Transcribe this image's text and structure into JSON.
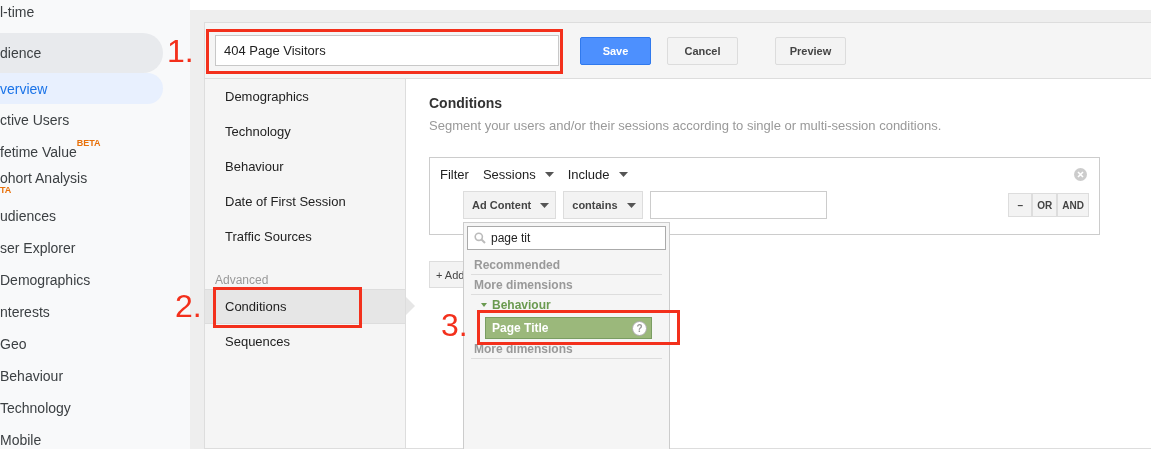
{
  "sidebar": {
    "items": [
      {
        "label": "l-time",
        "kind": "page",
        "selected": false
      },
      {
        "label": "dience",
        "kind": "group",
        "selected": false
      },
      {
        "label": "verview",
        "kind": "page",
        "selected": true
      },
      {
        "label": "ctive Users",
        "kind": "page",
        "selected": false
      },
      {
        "label": "fetime Value",
        "kind": "page",
        "selected": false,
        "badge": "BETA",
        "badge_wrapped": false
      },
      {
        "label": "ohort Analysis",
        "kind": "page",
        "selected": false,
        "badge": "TA",
        "badge_wrapped": true
      },
      {
        "label": "udiences",
        "kind": "page",
        "selected": false
      },
      {
        "label": "ser Explorer",
        "kind": "page",
        "selected": false
      },
      {
        "label": "Demographics",
        "kind": "page",
        "selected": false
      },
      {
        "label": "nterests",
        "kind": "page",
        "selected": false
      },
      {
        "label": "Geo",
        "kind": "page",
        "selected": false
      },
      {
        "label": "Behaviour",
        "kind": "page",
        "selected": false
      },
      {
        "label": "Technology",
        "kind": "page",
        "selected": false
      },
      {
        "label": "Mobile",
        "kind": "page",
        "selected": false
      }
    ]
  },
  "editor": {
    "segment_name": "404 Page Visitors",
    "buttons": [
      {
        "label": "Save",
        "kind": "primary"
      },
      {
        "label": "Cancel",
        "kind": "default"
      },
      {
        "label": "Preview",
        "kind": "default"
      }
    ],
    "nav": [
      {
        "label": "Demographics",
        "kind": "item",
        "selected": false
      },
      {
        "label": "Technology",
        "kind": "item",
        "selected": false
      },
      {
        "label": "Behaviour",
        "kind": "item",
        "selected": false
      },
      {
        "label": "Date of First Session",
        "kind": "item",
        "selected": false
      },
      {
        "label": "Traffic Sources",
        "kind": "item",
        "selected": false
      },
      {
        "label": "Advanced",
        "kind": "heading"
      },
      {
        "label": "Conditions",
        "kind": "item",
        "selected": true
      },
      {
        "label": "Sequences",
        "kind": "item",
        "selected": false
      }
    ]
  },
  "conditions": {
    "title": "Conditions",
    "description": "Segment your users and/or their sessions according to single or multi-session conditions.",
    "filter": {
      "label": "Filter",
      "scope": "Sessions",
      "mode": "Include",
      "dimension": "Ad Content",
      "operator": "contains",
      "logic_buttons": [
        "–",
        "OR",
        "AND"
      ]
    },
    "add_button": "+ Add",
    "dimension_menu": {
      "search_value": "page tit",
      "entries": [
        {
          "kind": "heading",
          "label": "Recommended"
        },
        {
          "kind": "heading",
          "label": "More dimensions"
        },
        {
          "kind": "category",
          "label": "Behaviour",
          "expanded": true
        },
        {
          "kind": "option",
          "label": "Page Title",
          "selected": true,
          "help": "?"
        },
        {
          "kind": "heading",
          "label": "More dimensions"
        }
      ]
    }
  },
  "annotations": [
    {
      "label": "1."
    },
    {
      "label": "2."
    },
    {
      "label": "3."
    }
  ]
}
